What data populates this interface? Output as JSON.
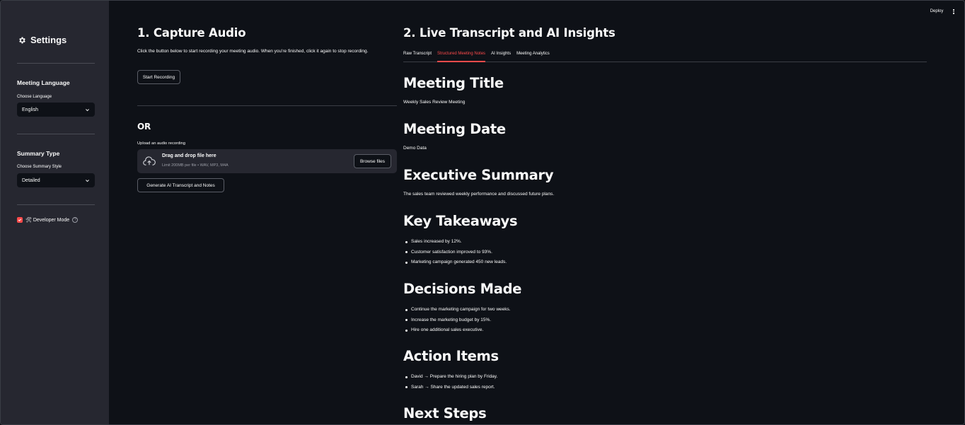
{
  "topbar": {
    "deploy_label": "Deploy"
  },
  "sidebar": {
    "title": "Settings",
    "language": {
      "heading": "Meeting Language",
      "label": "Choose Language",
      "selected": "English"
    },
    "summary": {
      "heading": "Summary Type",
      "label": "Choose Summary Style",
      "selected": "Detailed"
    },
    "developer_mode": {
      "label": "🛠 Developer Mode",
      "checked": true
    }
  },
  "capture": {
    "title": "1. Capture Audio",
    "instructions": "Click the button below to start recording your meeting audio. When you're finished, click it again to stop recording.",
    "record_button": "Start Recording",
    "or_label": "OR",
    "upload_label": "Upload an audio recording",
    "dropzone_title": "Drag and drop file here",
    "dropzone_limit": "Limit 200MB per file • WAV, MP3, M4A",
    "browse_button": "Browse files",
    "generate_button": "Generate AI Transcript and Notes"
  },
  "insights": {
    "title": "2. Live Transcript and AI Insights",
    "tabs": [
      "Raw Transcript",
      "Structured Meeting Notes",
      "AI Insights",
      "Meeting Analytics"
    ],
    "active_tab": "Structured Meeting Notes",
    "notes": {
      "meeting_title_h": "Meeting Title",
      "meeting_title": "Weekly Sales Review Meeting",
      "meeting_date_h": "Meeting Date",
      "meeting_date": "Demo Data",
      "summary_h": "Executive Summary",
      "summary": "The sales team reviewed weekly performance and discussed future plans.",
      "takeaways_h": "Key Takeaways",
      "takeaways": [
        "Sales increased by 12%.",
        "Customer satisfaction improved to 93%.",
        "Marketing campaign generated 450 new leads."
      ],
      "decisions_h": "Decisions Made",
      "decisions": [
        "Continue the marketing campaign for two weeks.",
        "Increase the marketing budget by 15%.",
        "Hire one additional sales executive."
      ],
      "actions_h": "Action Items",
      "actions": [
        "David → Prepare the hiring plan by Friday.",
        "Sarah → Share the updated sales report."
      ],
      "next_steps_h": "Next Steps"
    }
  },
  "colors": {
    "accent": "#ff4b4b",
    "background": "#0e1117",
    "sidebar": "#262730"
  }
}
